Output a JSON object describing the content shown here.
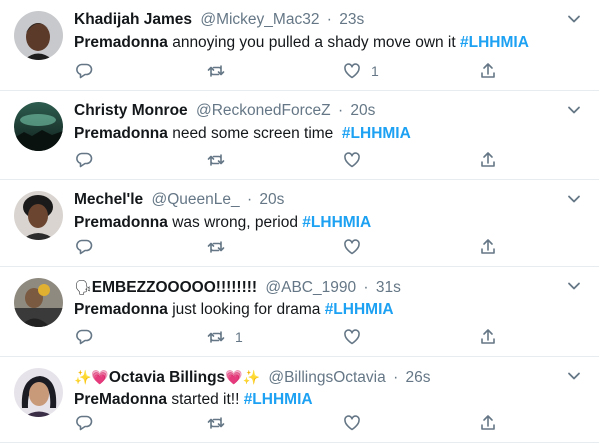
{
  "icons": {
    "more": "chevron-down-icon",
    "reply": "reply-icon",
    "retweet": "retweet-icon",
    "like": "heart-icon",
    "share": "share-icon"
  },
  "colors": {
    "hashtag": "#1da1f2",
    "meta": "#657786",
    "divider": "#e6ecf0"
  },
  "tweets": [
    {
      "name": "Khadijah James",
      "handle": "@Mickey_Mac32",
      "time": "23s",
      "bold": "Premadonna",
      "body": " annoying you pulled a shady move own it ",
      "hashtag": "#LHHMIA",
      "replies": "",
      "retweets": "",
      "likes": "1"
    },
    {
      "name": "Christy Monroe",
      "handle": "@ReckonedForceZ",
      "time": "20s",
      "bold": "Premadonna",
      "body": " need some screen time  ",
      "hashtag": "#LHHMIA",
      "replies": "",
      "retweets": "",
      "likes": ""
    },
    {
      "name": "Mechel'le",
      "handle": "@QueenLe_",
      "time": "20s",
      "bold": "Premadonna",
      "body": " was wrong, period ",
      "hashtag": "#LHHMIA",
      "replies": "",
      "retweets": "",
      "likes": ""
    },
    {
      "name_emoji": "🗣",
      "name": "EMBEZZOOOOO!!!!!!!!",
      "handle": "@ABC_1990",
      "time": "31s",
      "bold": "Premadonna",
      "body": " just looking for drama ",
      "hashtag": "#LHHMIA",
      "replies": "",
      "retweets": "1",
      "likes": ""
    },
    {
      "name_prefix": "✨💗",
      "name": "Octavia Billings",
      "name_suffix": "💗✨",
      "handle": "@BillingsOctavia",
      "time": "26s",
      "bold": "PreMadonna",
      "body": " started it!! ",
      "hashtag": "#LHHMIA",
      "replies": "",
      "retweets": "",
      "likes": ""
    }
  ]
}
